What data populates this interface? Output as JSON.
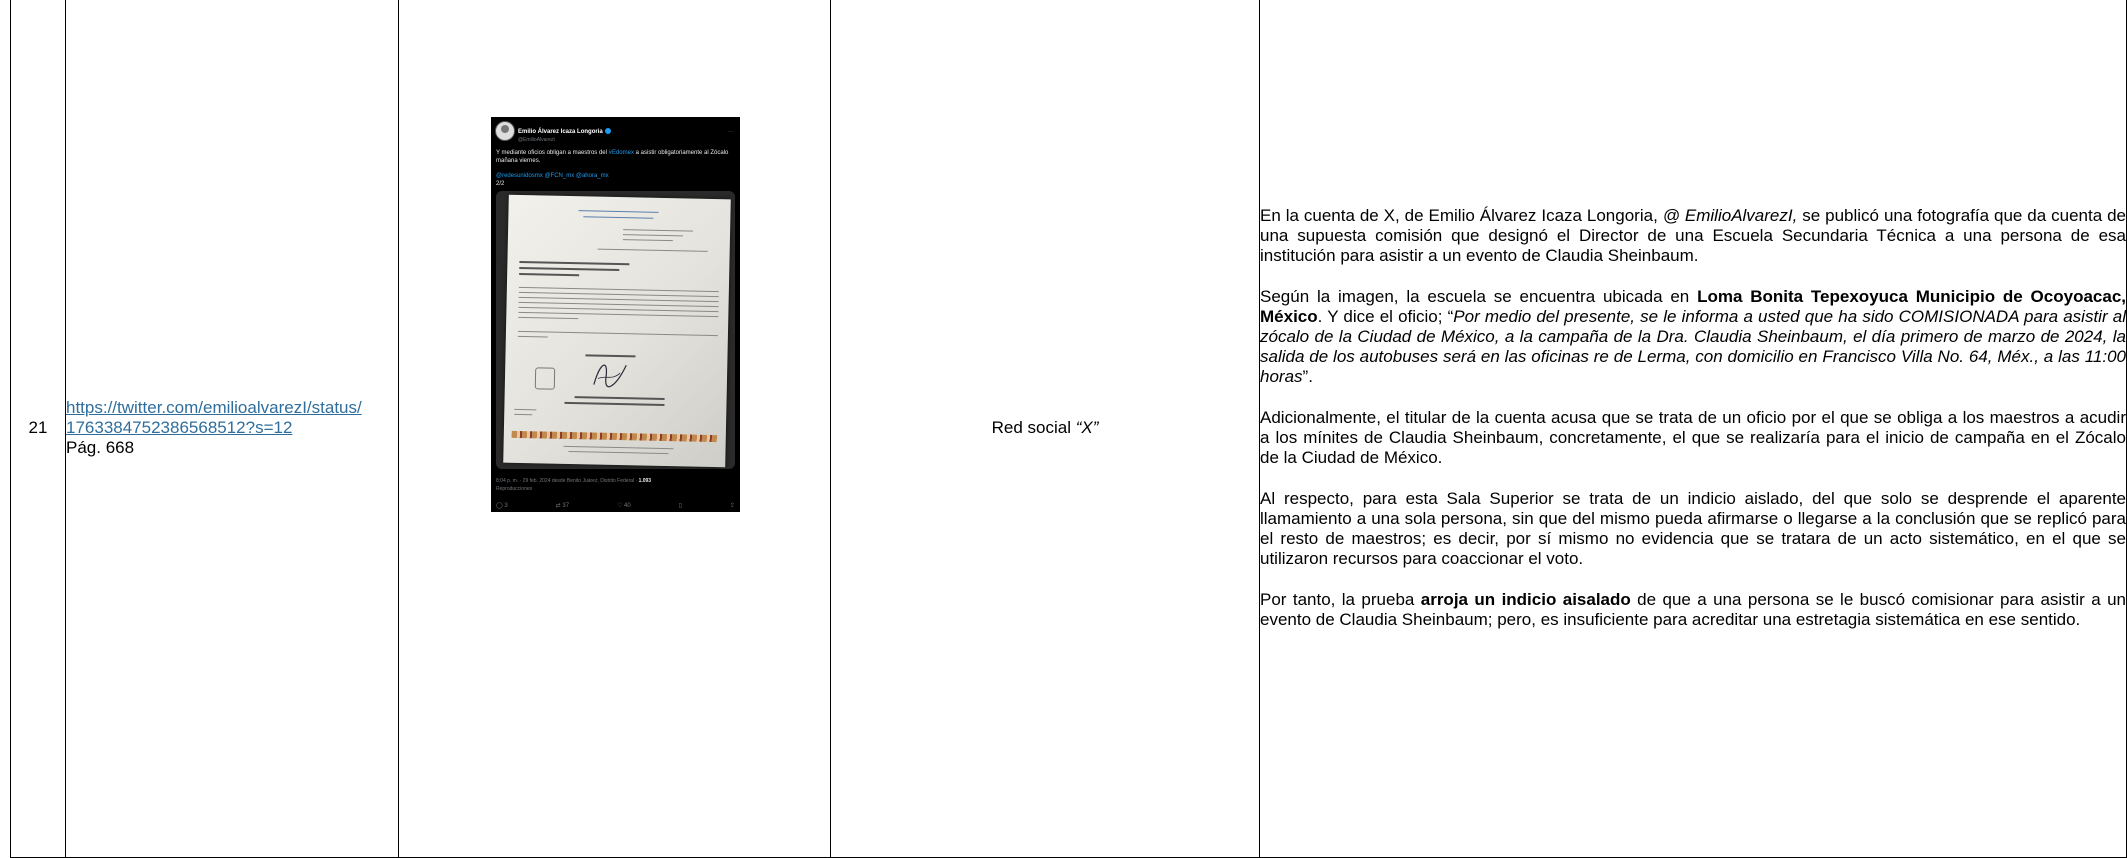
{
  "row": {
    "number": "21",
    "link_line1": "https://twitter.com/emilioalvarezI/status/",
    "link_line2": "1763384752386568512?s=12",
    "page": "Pág. 668",
    "medium_prefix": "Red social ",
    "medium_name": "“X”"
  },
  "tweet": {
    "author": "Emilio Álvarez Icaza Longoria",
    "handle": "@EmilioAlvarezI",
    "text_pre": "Y mediante oficios obligan a maestros del ",
    "hashtag": "#Edomex",
    "text_post": " a asistir obligatoriamente al Zócalo mañana viernes.",
    "mentions": "@redesunidosmx @FCN_mx @ahora_mx",
    "count": "2/2",
    "footer": "8:04 p. m. · 29 feb. 2024 desde Benito Juárez, Distrito Federal · ",
    "views": "1.093",
    "reproductions": "Reproducciones",
    "actions": [
      "3",
      "37",
      "40",
      "",
      ""
    ],
    "icons": [
      "reply-icon",
      "retweet-icon",
      "like-icon",
      "bookmark-icon",
      "share-icon"
    ]
  },
  "description": {
    "p1_a": "En la cuenta de X, de Emilio Álvarez Icaza Longoria, ",
    "p1_handle": "@ EmilioAlvarezI,",
    "p1_b": " se publicó una fotografía que da cuenta de una supuesta comisión que designó el Director de una Escuela Secundaria Técnica a una persona de esa institución para asistir a un evento de Claudia Sheinbaum.",
    "p2_a": "Según la imagen, la escuela se encuentra ubicada en ",
    "p2_bold": "Loma Bonita Tepexoyuca Municipio de Ocoyoacac, México",
    "p2_b": ". Y dice el oficio; “",
    "p2_quote": "Por medio del presente, se le informa a usted que ha sido COMISIONADA para asistir al zócalo de la Ciudad de México, a la campaña de la Dra. Claudia Sheinbaum, el día primero de marzo de 2024, la salida de los autobuses será en las oficinas re de Lerma, con domicilio en Francisco Villa No. 64, Méx., a las 11:00 horas",
    "p2_c": "”.",
    "p3": "Adicionalmente, el titular de la cuenta acusa que se trata de un oficio por el que se obliga a los maestros a acudir a los mínites de Claudia Sheinbaum, concretamente, el que se realizaría para el inicio de campaña en el Zócalo de la Ciudad de México.",
    "p4": "Al respecto, para esta Sala Superior se trata de un indicio aislado, del que solo se desprende el aparente llamamiento a una sola persona, sin que del mismo pueda afirmarse o llegarse a la conclusión que se replicó para el resto de maestros; es decir, por sí mismo no evidencia que se tratara de un acto sistemático, en el que se utilizaron recursos para coaccionar el voto.",
    "p5_a": "Por tanto, la prueba ",
    "p5_bold": "arroja un indicio aisalado",
    "p5_b": " de que a una persona se le buscó comisionar para asistir a un evento de Claudia Sheinbaum; pero, es insuficiente para acreditar una estretagia sistemática en ese sentido."
  },
  "colors": {
    "link": "#2f6e9c",
    "tweet_bg": "#000000",
    "tweet_accent": "#1d9bf0"
  }
}
